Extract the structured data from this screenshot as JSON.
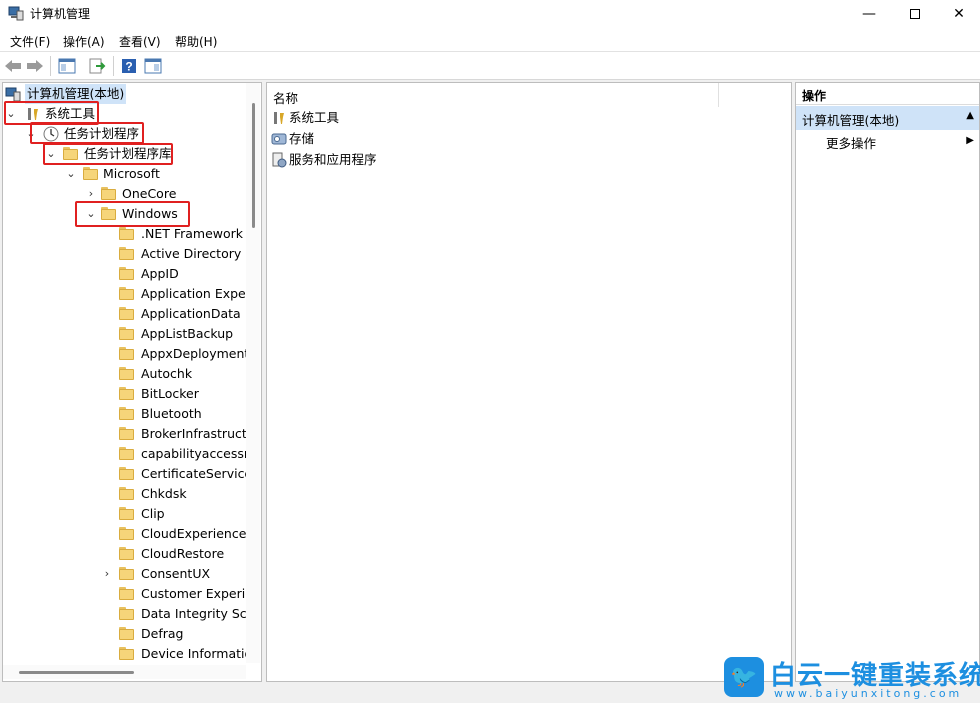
{
  "window": {
    "title": "计算机管理"
  },
  "menu": [
    "文件(F)",
    "操作(A)",
    "查看(V)",
    "帮助(H)"
  ],
  "tree": {
    "root": "计算机管理(本地)",
    "system_tools": "系统工具",
    "task_scheduler": "任务计划程序",
    "task_library": "任务计划程序库",
    "microsoft": "Microsoft",
    "onecore": "OneCore",
    "windows": "Windows",
    "windows_children": [
      ".NET Framework",
      "Active Directory R",
      "AppID",
      "Application Exper",
      "ApplicationData",
      "AppListBackup",
      "AppxDeploymentC",
      "Autochk",
      "BitLocker",
      "Bluetooth",
      "BrokerInfrastructu",
      "capabilityaccessm",
      "CertificateServices",
      "Chkdsk",
      "Clip",
      "CloudExperienceH",
      "CloudRestore",
      "ConsentUX",
      "Customer Experie",
      "Data Integrity Sca",
      "Defrag",
      "Device Informatio"
    ]
  },
  "middle": {
    "column_header": "名称",
    "items": [
      "系统工具",
      "存储",
      "服务和应用程序"
    ]
  },
  "actions": {
    "header": "操作",
    "section": "计算机管理(本地)",
    "more": "更多操作"
  },
  "watermark": {
    "text": "白云一键重装系统",
    "url": "www.baiyunxitong.com"
  },
  "colors": {
    "highlight": "#e02020",
    "selected_section": "#cfe3f8",
    "folder": "#f6d57a",
    "brand": "#1d8fe0"
  }
}
